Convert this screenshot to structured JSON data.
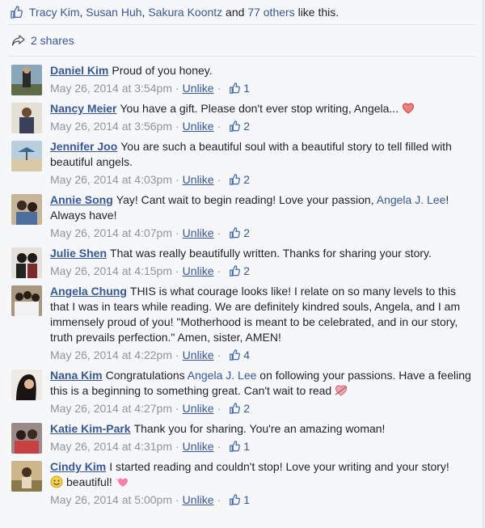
{
  "likes": {
    "names": [
      "Tracy Kim",
      "Susan Huh",
      "Sakura Koontz"
    ],
    "sep1": ", ",
    "sep2": ", ",
    "and_text": " and ",
    "others": "77 others",
    "suffix": " like this."
  },
  "shares": {
    "label": "2 shares"
  },
  "colors": {
    "link": "#365899",
    "meta": "#90949c",
    "text": "#1d2129"
  },
  "comments": [
    {
      "author": "Daniel Kim",
      "text": "Proud of you honey.",
      "timestamp": "May 26, 2014 at 3:54pm",
      "unlike": "Unlike",
      "like_count": "1",
      "avatar": "avatar-photo"
    },
    {
      "author": "Nancy Meier",
      "text": "You have a gift. Please don't ever stop writing, Angela...",
      "timestamp": "May 26, 2014 at 3:56pm",
      "unlike": "Unlike",
      "like_count": "2",
      "icon": "heart-icon"
    },
    {
      "author": "Jennifer Joo",
      "text": "You are such a beautiful soul with a beautiful story to tell filled with beautiful angels.",
      "timestamp": "May 26, 2014 at 4:03pm",
      "unlike": "Unlike",
      "like_count": "2"
    },
    {
      "author": "Annie Song",
      "text_before": "Yay! Cant wait to begin reading! Love your passion, ",
      "mention": "Angela J. Lee",
      "text_after": "! Always have!",
      "timestamp": "May 26, 2014 at 4:07pm",
      "unlike": "Unlike",
      "like_count": "2"
    },
    {
      "author": "Julie Shen",
      "text": "That was really beautifully written. Thanks for sharing your story.",
      "timestamp": "May 26, 2014 at 4:15pm",
      "unlike": "Unlike",
      "like_count": "2"
    },
    {
      "author": "Angela Chung",
      "text": "THIS is what courage looks like! I relate on so many levels to this that I was in tears while reading. We are definitely kindred souls, Angela, and I am immensely proud of you! \"Motherhood is meant to be celebrated, and in our story, truth prevails perfection.\" Amen, sister, AMEN!",
      "timestamp": "May 26, 2014 at 4:22pm",
      "unlike": "Unlike",
      "like_count": "4"
    },
    {
      "author": "Nana Kim",
      "text_before": "Congratulations ",
      "mention": "Angela J. Lee",
      "text_after": " on following your passions. Have a feeling this is a beginning to something great. Can't wait to read",
      "timestamp": "May 26, 2014 at 4:27pm",
      "unlike": "Unlike",
      "like_count": "2",
      "icon": "cupid-heart-icon"
    },
    {
      "author": "Katie Kim-Park",
      "text": "Thank you for sharing. You're an amazing woman!",
      "timestamp": "May 26, 2014 at 4:31pm",
      "unlike": "Unlike",
      "like_count": "1"
    },
    {
      "author": "Cindy Kim",
      "text": "I started reading and couldn't stop! Love your writing and your story!",
      "text_tail": "beautiful!",
      "timestamp": "May 26, 2014 at 5:00pm",
      "unlike": "Unlike",
      "like_count": "1",
      "icons": [
        "smile-emoji-icon",
        "sparkle-heart-icon"
      ]
    }
  ]
}
